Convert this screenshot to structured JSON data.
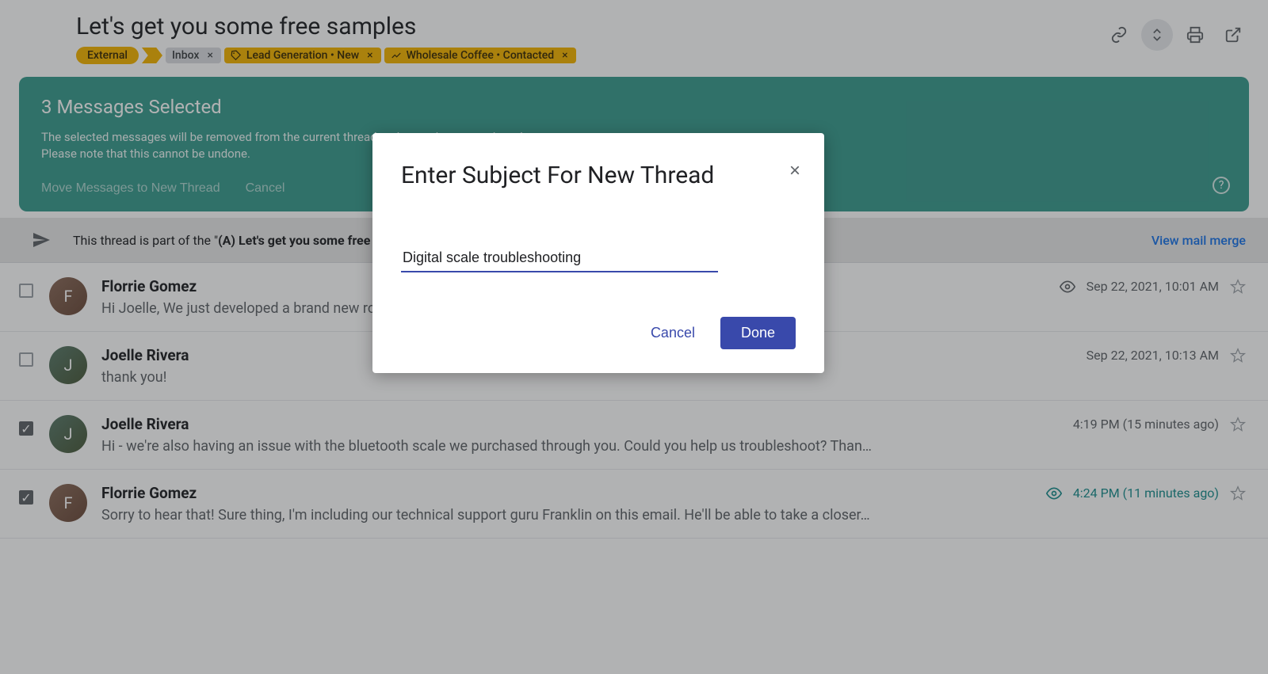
{
  "thread": {
    "title": "Let's get you some free samples",
    "labels": {
      "external": "External",
      "inbox": "Inbox",
      "lead": "Lead Generation • New",
      "wholesale": "Wholesale Coffee • Contacted"
    }
  },
  "banner": {
    "title": "3 Messages Selected",
    "line1": "The selected messages will be removed from the current thread and moved to a new thread.",
    "line2": "Please note that this cannot be undone.",
    "move_btn": "Move Messages to New Thread",
    "cancel_btn": "Cancel"
  },
  "merge_notice": {
    "prefix": "This thread is part of the \"",
    "name": "(A) Let's get you some free samples",
    "link": "View mail merge"
  },
  "messages": [
    {
      "sender": "Florrie Gomez",
      "snippet": "Hi Joelle, We just developed a brand new roast. Would you like to try some free samples? We're…",
      "time": "Sep 22, 2021, 10:01 AM",
      "checked": false,
      "eye": true,
      "eye_teal": false
    },
    {
      "sender": "Joelle Rivera",
      "snippet": "thank you!",
      "time": "Sep 22, 2021, 10:13 AM",
      "checked": false,
      "eye": false,
      "eye_teal": false
    },
    {
      "sender": "Joelle Rivera",
      "snippet": "Hi - we're also having an issue with the bluetooth scale we purchased through you. Could you help us troubleshoot? Than…",
      "time": "4:19 PM (15 minutes ago)",
      "checked": true,
      "eye": false,
      "eye_teal": false
    },
    {
      "sender": "Florrie Gomez",
      "snippet": "Sorry to hear that! Sure thing, I'm including our technical support guru Franklin on this email. He'll be able to take a closer…",
      "time": "4:24 PM (11 minutes ago)",
      "checked": true,
      "eye": true,
      "eye_teal": true
    }
  ],
  "dialog": {
    "title": "Enter Subject For New Thread",
    "input_value": "Digital scale troubleshooting",
    "cancel": "Cancel",
    "done": "Done"
  }
}
